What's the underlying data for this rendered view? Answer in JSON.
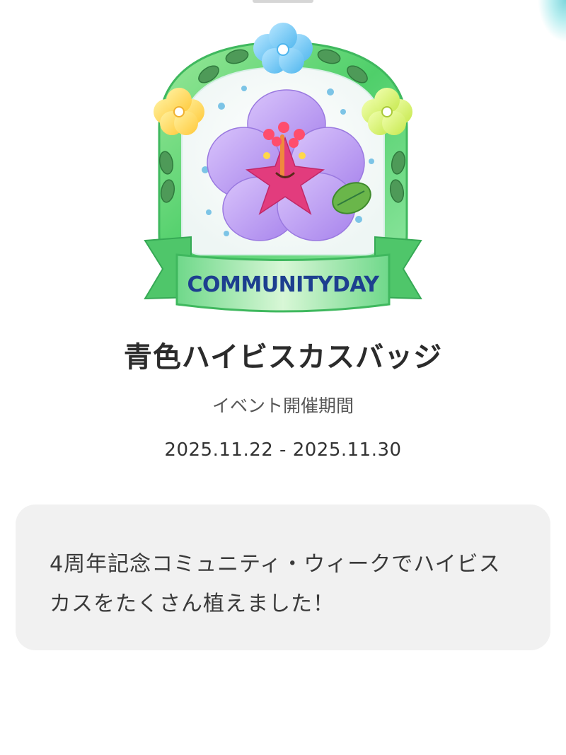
{
  "badge": {
    "banner_text": "COMMUNITYDAY",
    "icon_name": "blue-hibiscus-badge-icon",
    "colors": {
      "frame_green": "#4fcf6a",
      "frame_light": "#c9f5c4",
      "petal_purple": "#b58ef0",
      "petal_light": "#cdb8f8",
      "stamen_pink": "#e23c7d",
      "banner_text": "#1d3f8f",
      "top_flower": "#6cc6f2",
      "side_flower_yellow": "#ffd84a",
      "side_flower_lime": "#d8f06a"
    }
  },
  "title": "青色ハイビスカスバッジ",
  "period": {
    "label": "イベント開催期間",
    "dates": "2025.11.22 - 2025.11.30"
  },
  "description": "4周年記念コミュニティ・ウィークでハイビスカスをたくさん植えました！"
}
